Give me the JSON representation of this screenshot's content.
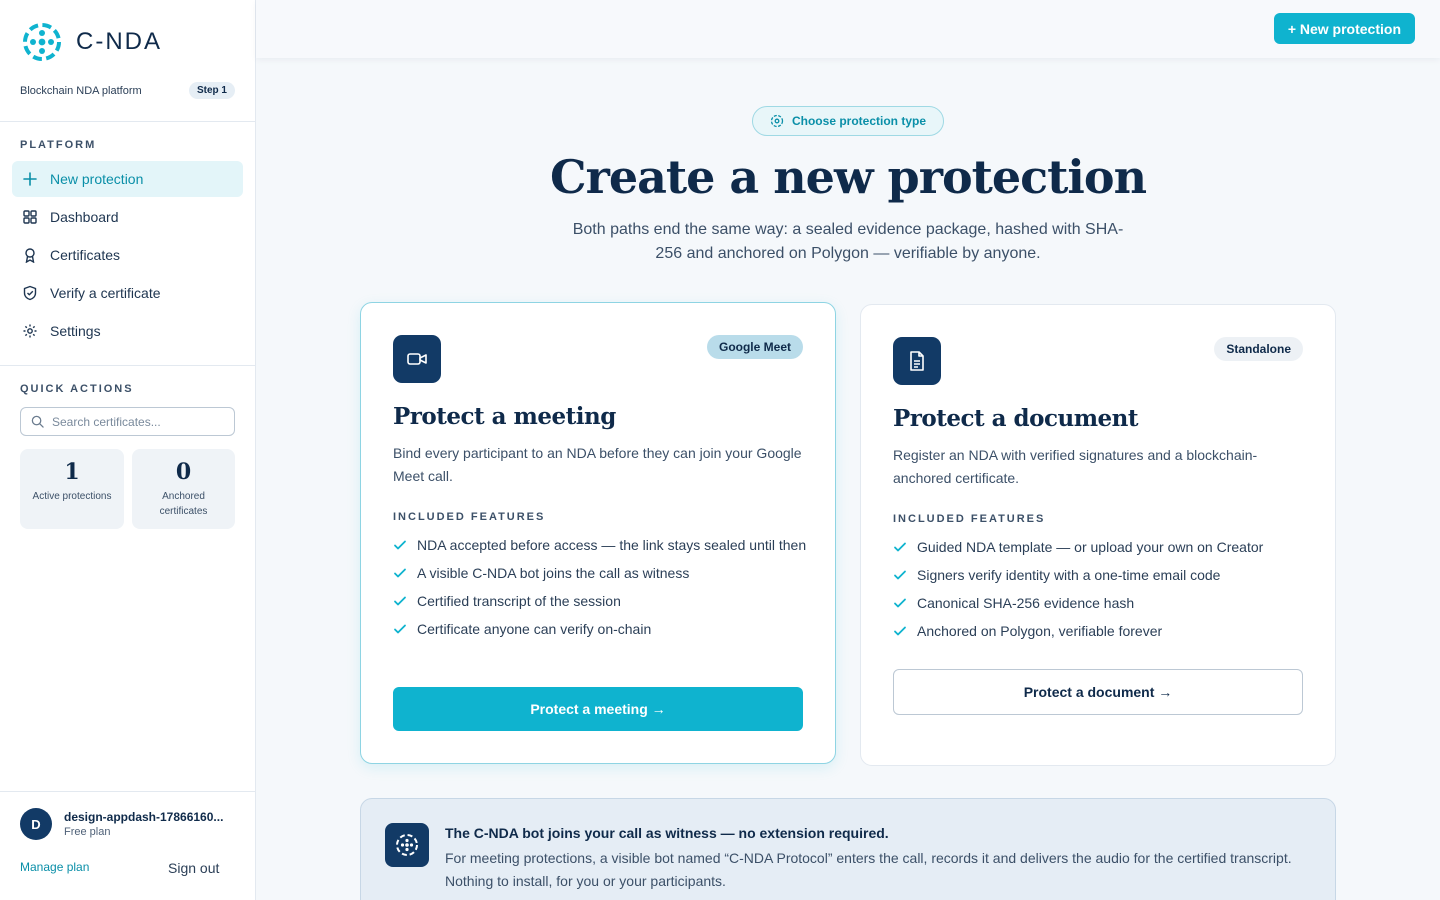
{
  "brand": {
    "name": "C-NDA",
    "tagline": "Blockchain NDA platform",
    "step": "Step 1"
  },
  "sidebar": {
    "platform_label": "PLATFORM",
    "items": [
      {
        "label": "New protection",
        "icon": "plus-icon",
        "active": true
      },
      {
        "label": "Dashboard",
        "icon": "grid-icon",
        "active": false
      },
      {
        "label": "Certificates",
        "icon": "award-icon",
        "active": false
      },
      {
        "label": "Verify a certificate",
        "icon": "shield-check-icon",
        "active": false
      },
      {
        "label": "Settings",
        "icon": "gear-icon",
        "active": false
      }
    ],
    "quick_actions_label": "QUICK ACTIONS",
    "search_placeholder": "Search certificates...",
    "stats": [
      {
        "value": "1",
        "label": "Active protections"
      },
      {
        "value": "0",
        "label": "Anchored certificates"
      }
    ],
    "user": {
      "initial": "D",
      "name": "design-appdash-17866160...",
      "plan": "Free plan"
    },
    "manage_plan": "Manage plan",
    "sign_out": "Sign out"
  },
  "topbar": {
    "new_button": "+ New protection"
  },
  "main": {
    "pill": "Choose protection type",
    "title": "Create a new protection",
    "subtitle": "Both paths end the same way: a sealed evidence package, hashed with SHA-256 and anchored on Polygon — verifiable by anyone.",
    "features_label": "INCLUDED FEATURES",
    "cards": [
      {
        "tag": "Google Meet",
        "title": "Protect a meeting",
        "description": "Bind every participant to an NDA before they can join your Google Meet call.",
        "features": [
          "NDA accepted before access — the link stays sealed until then",
          "A visible C-NDA bot joins the call as witness",
          "Certified transcript of the session",
          "Certificate anyone can verify on-chain"
        ],
        "button": "Protect a meeting →"
      },
      {
        "tag": "Standalone",
        "title": "Protect a document",
        "description": "Register an NDA with verified signatures and a blockchain-anchored certificate.",
        "features": [
          "Guided NDA template — or upload your own on Creator",
          "Signers verify identity with a one-time email code",
          "Canonical SHA-256 evidence hash",
          "Anchored on Polygon, verifiable forever"
        ],
        "button": "Protect a document →"
      }
    ],
    "banner": {
      "title": "The C-NDA bot joins your call as witness — no extension required.",
      "text": "For meeting protections, a visible bot named “C-NDA Protocol” enters the call, records it and delivers the audio for the certified transcript. Nothing to install, for you or your participants."
    }
  },
  "colors": {
    "accent": "#0fb3cf",
    "navy": "#123a66",
    "text": "#0f2a4a"
  }
}
